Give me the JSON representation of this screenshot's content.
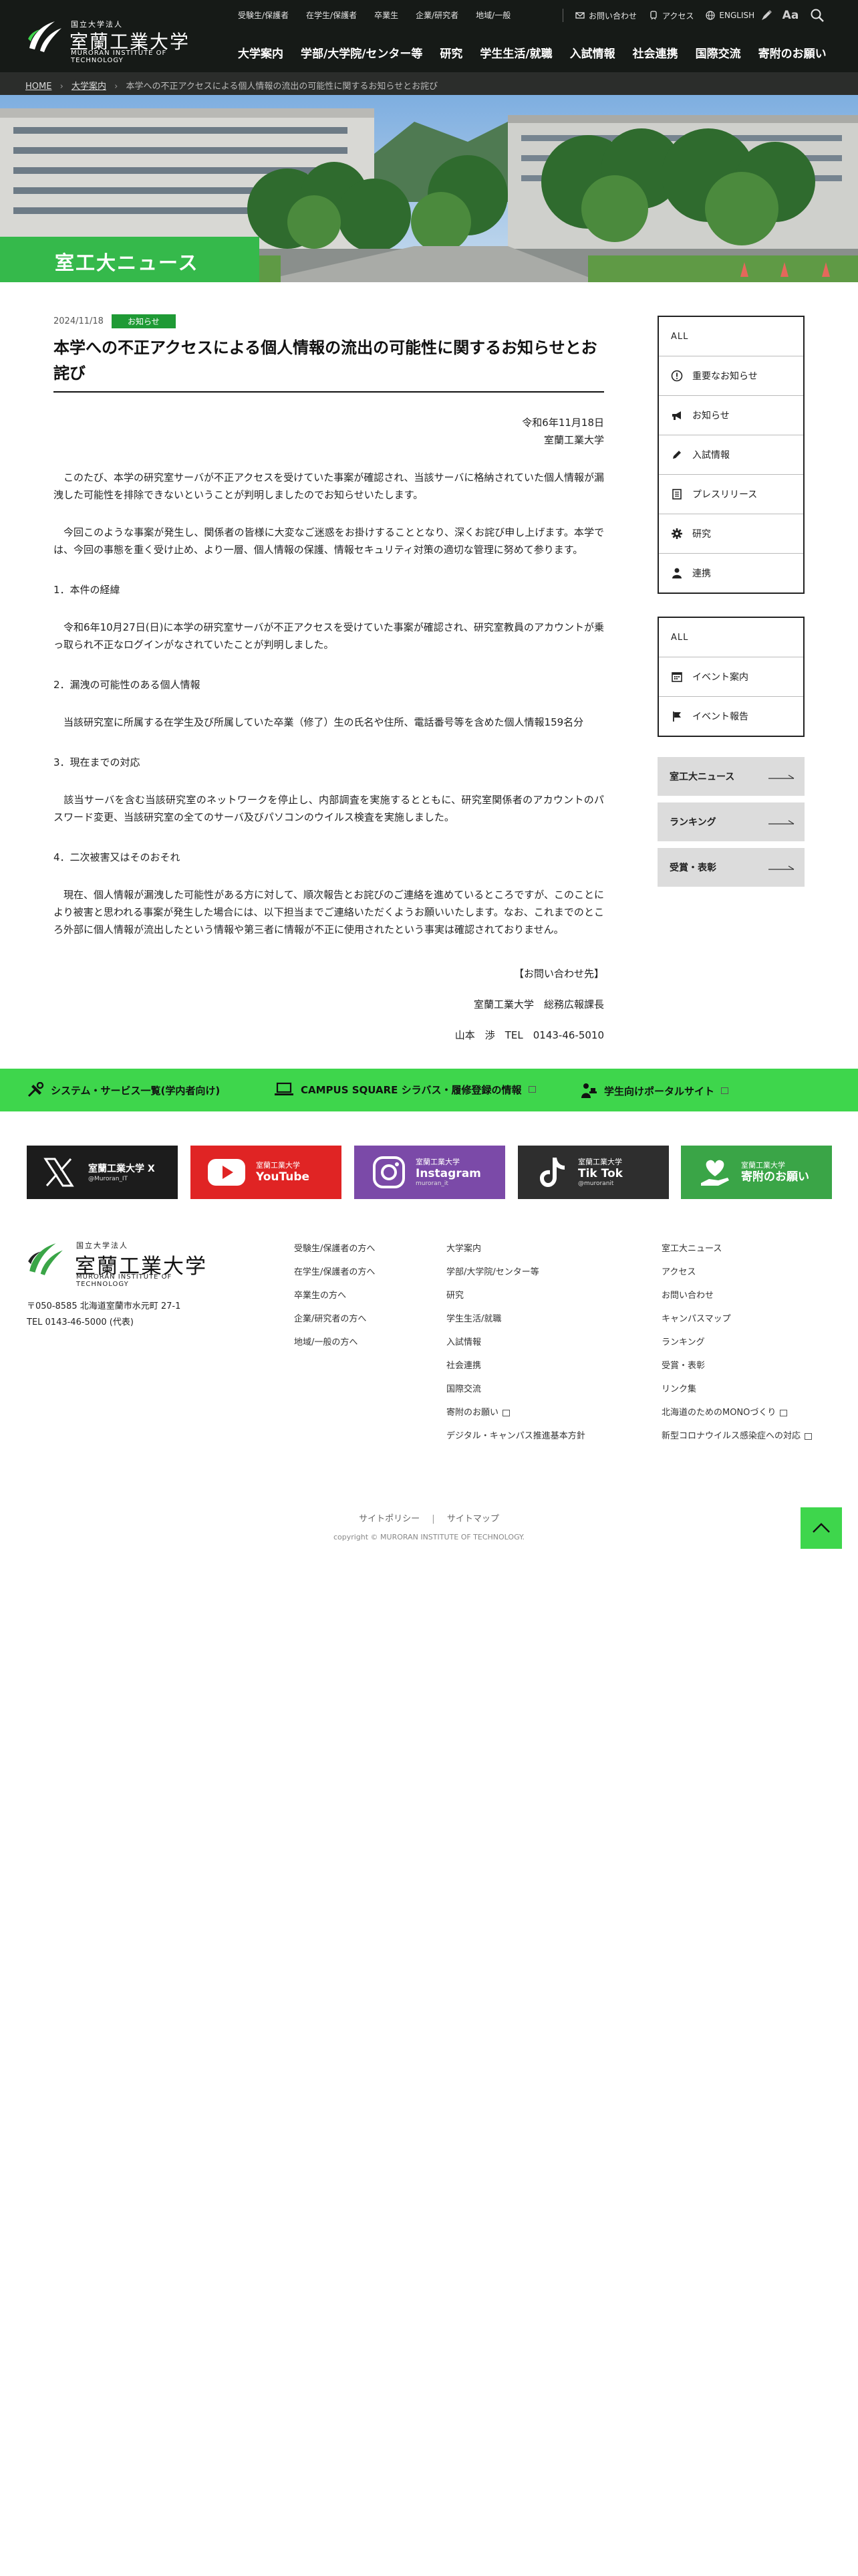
{
  "header": {
    "logo": {
      "small": "国立大学法人",
      "name": "室蘭工業大学",
      "en": "MURORAN INSTITUTE OF TECHNOLOGY"
    },
    "top_links": [
      "受験生/保護者",
      "在学生/保護者",
      "卒業生",
      "企業/研究者",
      "地域/一般"
    ],
    "utility": {
      "contact": "お問い合わせ",
      "access": "アクセス",
      "english": "ENGLISH",
      "font_size": "Aa"
    },
    "main_nav": [
      "大学案内",
      "学部/大学院/センター等",
      "研究",
      "学生生活/就職",
      "入試情報",
      "社会連携",
      "国際交流",
      "寄附のお願い"
    ]
  },
  "breadcrumb": {
    "home": "HOME",
    "section": "大学案内",
    "current": "本学への不正アクセスによる個人情報の流出の可能性に関するお知らせとお詫び",
    "separator": "›"
  },
  "hero": {
    "title": "室工大ニュース"
  },
  "article": {
    "date": "2024/11/18",
    "category": "お知らせ",
    "title": "本学への不正アクセスによる個人情報の流出の可能性に関するお知らせとお詫び",
    "issue_date": "令和6年11月18日",
    "issuer": "室蘭工業大学",
    "p1": "　このたび、本学の研究室サーバが不正アクセスを受けていた事案が確認され、当該サーバに格納されていた個人情報が漏洩した可能性を排除できないということが判明しましたのでお知らせいたします。",
    "p2": "　今回このような事案が発生し、関係者の皆様に大変なご迷惑をお掛けすることとなり、深くお詫び申し上げます。本学では、今回の事態を重く受け止め、より一層、個人情報の保護、情報セキュリティ対策の適切な管理に努めて参ります。",
    "h1": "1．本件の経緯",
    "p3": "　令和6年10月27日(日)に本学の研究室サーバが不正アクセスを受けていた事案が確認され、研究室教員のアカウントが乗っ取られ不正なログインがなされていたことが判明しました。",
    "h2": "2．漏洩の可能性のある個人情報",
    "p4": "　当該研究室に所属する在学生及び所属していた卒業（修了）生の氏名や住所、電話番号等を含めた個人情報159名分",
    "h3": "3．現在までの対応",
    "p5": "　該当サーバを含む当該研究室のネットワークを停止し、内部調査を実施するとともに、研究室関係者のアカウントのパスワード変更、当該研究室の全てのサーバ及びパソコンのウイルス検査を実施しました。",
    "h4": "4．二次被害又はそのおそれ",
    "p6": "　現在、個人情報が漏洩した可能性がある方に対して、順次報告とお詫びのご連絡を進めているところですが、このことにより被害と思われる事案が発生した場合には、以下担当までご連絡いただくようお願いいたします。なお、これまでのところ外部に個人情報が流出したという情報や第三者に情報が不正に使用されたという事実は確認されておりません。",
    "contact_heading": "【お問い合わせ先】",
    "contact_dept": "室蘭工業大学　総務広報課長",
    "contact_person": "山本　渉　TEL　0143-46-5010"
  },
  "sidebar": {
    "news_box": {
      "all": "ALL",
      "items": [
        "重要なお知らせ",
        "お知らせ",
        "入試情報",
        "プレスリリース",
        "研究",
        "連携"
      ]
    },
    "event_box": {
      "all": "ALL",
      "items": [
        "イベント案内",
        "イベント報告"
      ]
    },
    "buttons": [
      "室工大ニュース",
      "ランキング",
      "受賞・表彰"
    ]
  },
  "green_bar": {
    "items": [
      "システム・サービス一覧(学内者向け)",
      "CAMPUS SQUARE シラバス・履修登録の情報",
      "学生向けポータルサイト"
    ]
  },
  "social": [
    {
      "label": "室蘭工業大学 X",
      "sub": "@Muroran_IT",
      "color": "#1c1c1c"
    },
    {
      "label": "室蘭工業大学",
      "name": "YouTube",
      "color": "#e02424"
    },
    {
      "label": "室蘭工業大学",
      "name": "Instagram",
      "sub": "muroran_it",
      "color": "#7b4aa8"
    },
    {
      "label": "室蘭工業大学",
      "name": "Tik Tok",
      "sub": "@muroranit",
      "color": "#2e2e2e"
    },
    {
      "label": "室蘭工業大学",
      "name": "寄附のお願い",
      "color": "#3aa547"
    }
  ],
  "footer": {
    "address": "〒050-8585 北海道室蘭市水元町 27-1",
    "tel": "TEL 0143-46-5000 (代表)",
    "col1": [
      "受験生/保護者の方へ",
      "在学生/保護者の方へ",
      "卒業生の方へ",
      "企業/研究者の方へ",
      "地域/一般の方へ"
    ],
    "col2": [
      "大学案内",
      "学部/大学院/センター等",
      "研究",
      "学生生活/就職",
      "入試情報",
      "社会連携",
      "国際交流",
      "寄附のお願い",
      "デジタル・キャンパス推進基本方針"
    ],
    "col3": [
      "室工大ニュース",
      "アクセス",
      "お問い合わせ",
      "キャンパスマップ",
      "ランキング",
      "受賞・表彰",
      "リンク集",
      "北海道のためのMONOづくり",
      "新型コロナウイルス感染症への対応"
    ],
    "bottom_links": [
      "サイトポリシー",
      "サイトマップ"
    ],
    "copyright": "copyright © MURORAN INSTITUTE OF TECHNOLOGY."
  },
  "colors": {
    "header_bg": "#161a17",
    "accent_green": "#3ed64c",
    "hero_title_green": "#35b94b",
    "badge_green": "#1f9a35"
  }
}
